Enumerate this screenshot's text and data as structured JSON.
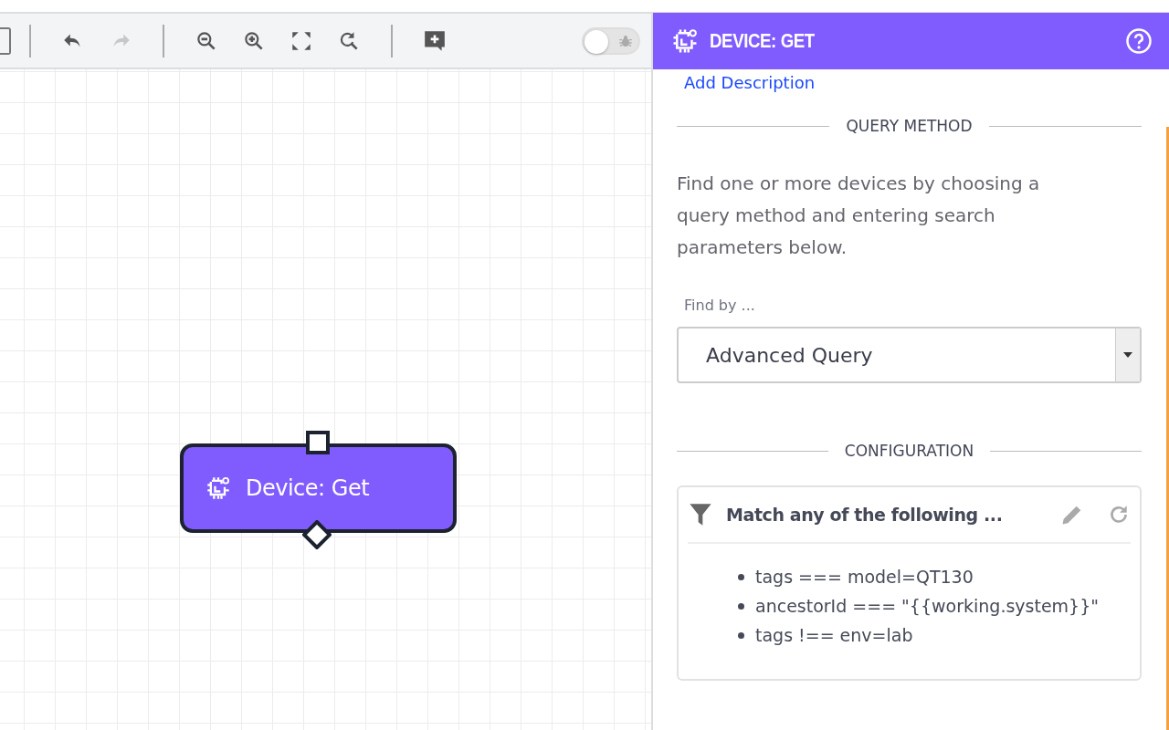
{
  "toolbar": {
    "buttons": [
      {
        "kind": "undo",
        "disabled": false
      },
      {
        "kind": "redo",
        "disabled": true
      },
      {
        "kind": "zoom-out",
        "disabled": false
      },
      {
        "kind": "zoom-in",
        "disabled": false
      },
      {
        "kind": "fit",
        "disabled": false
      },
      {
        "kind": "reset-zoom",
        "disabled": false
      },
      {
        "kind": "add-comment",
        "disabled": false
      }
    ],
    "debug_toggle": {
      "on": false
    }
  },
  "canvas": {
    "nodes": [
      {
        "label": "Device: Get",
        "selected": true
      }
    ]
  },
  "panel": {
    "title": "DEVICE: GET",
    "add_description": "Add Description",
    "sections": [
      {
        "kind": "query",
        "heading": "QUERY METHOD",
        "description": "Find one or more devices by choosing a query method and entering search parameters below.",
        "field_label": "Find by ...",
        "field_value": "Advanced Query"
      },
      {
        "kind": "config",
        "heading": "CONFIGURATION",
        "card_title": "Match any of the following ...",
        "items": [
          "tags === model=QT130",
          "ancestorId === \"{{working.system}}\"",
          "tags !== env=lab"
        ]
      }
    ]
  }
}
